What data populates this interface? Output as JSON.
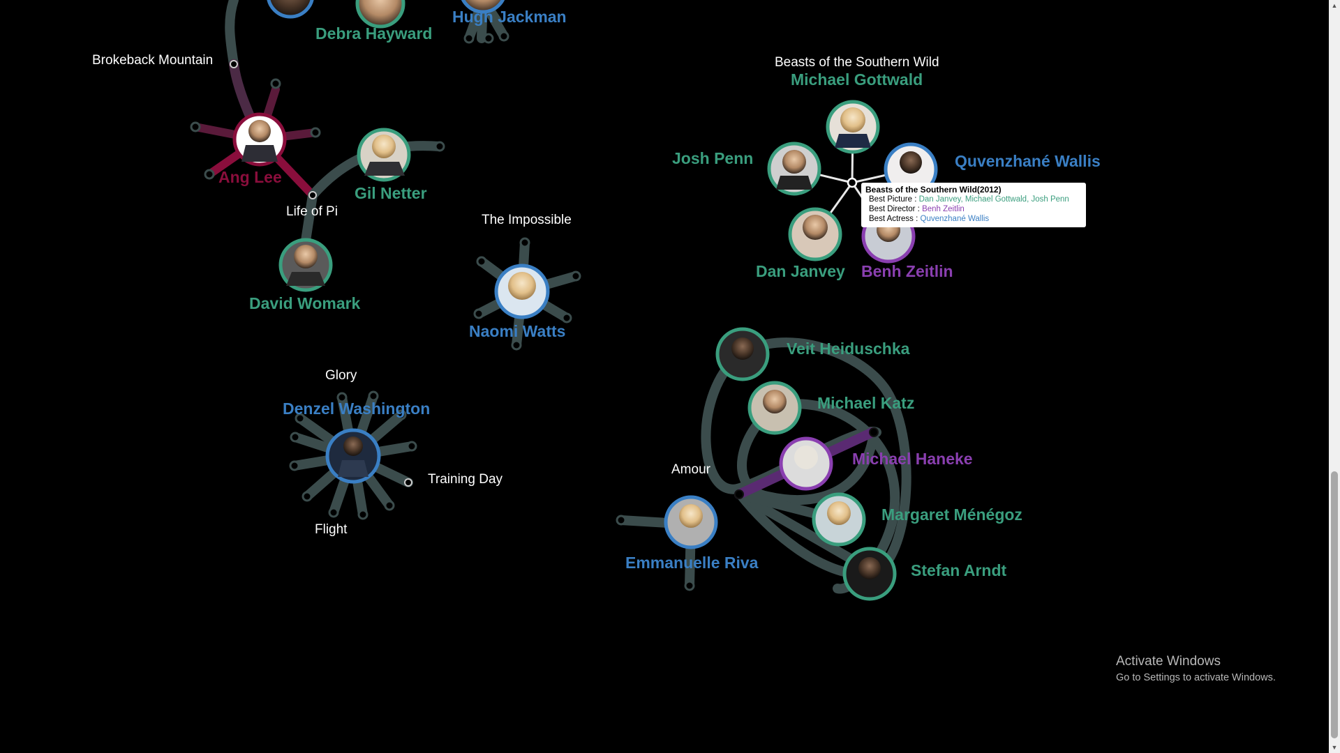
{
  "colors": {
    "background": "#000000",
    "picture": "#3a9e7e",
    "director": "#8a3fb0",
    "actor": "#3a7fc4",
    "highlight": "#8a0e3c",
    "edge": "#3b4c4c",
    "film_label": "#ffffff"
  },
  "films": {
    "brokeback": "Brokeback Mountain",
    "life_of_pi": "Life of Pi",
    "impossible": "The Impossible",
    "glory": "Glory",
    "training_day": "Training Day",
    "flight": "Flight",
    "amour": "Amour",
    "beasts": "Beasts of the Southern Wild"
  },
  "people": {
    "debra": "Debra Hayward",
    "hugh": "Hugh Jackman",
    "ang": "Ang Lee",
    "gil": "Gil Netter",
    "david": "David Womark",
    "naomi": "Naomi Watts",
    "denzel": "Denzel Washington",
    "gottwald": "Michael Gottwald",
    "josh": "Josh Penn",
    "quvenzhane": "Quvenzhané Wallis",
    "janvey": "Dan Janvey",
    "benh": "Benh Zeitlin",
    "veit": "Veit Heiduschka",
    "katz": "Michael Katz",
    "haneke": "Michael Haneke",
    "margaret": "Margaret Ménégoz",
    "stefan": "Stefan Arndt",
    "emmanuelle": "Emmanuelle Riva"
  },
  "tooltip": {
    "title": "Beasts of the Southern Wild(2012)",
    "rows": [
      {
        "label": "Best Picture",
        "value": "Dan Janvey, Michael Gottwald, Josh Penn",
        "color": "picture"
      },
      {
        "label": "Best Director",
        "value": "Benh Zeitlin",
        "color": "director"
      },
      {
        "label": "Best Actress",
        "value": "Quvenzhané Wallis",
        "color": "actor"
      }
    ],
    "separator": ":"
  },
  "watermark": {
    "title": "Activate Windows",
    "subtitle": "Go to Settings to activate Windows."
  }
}
